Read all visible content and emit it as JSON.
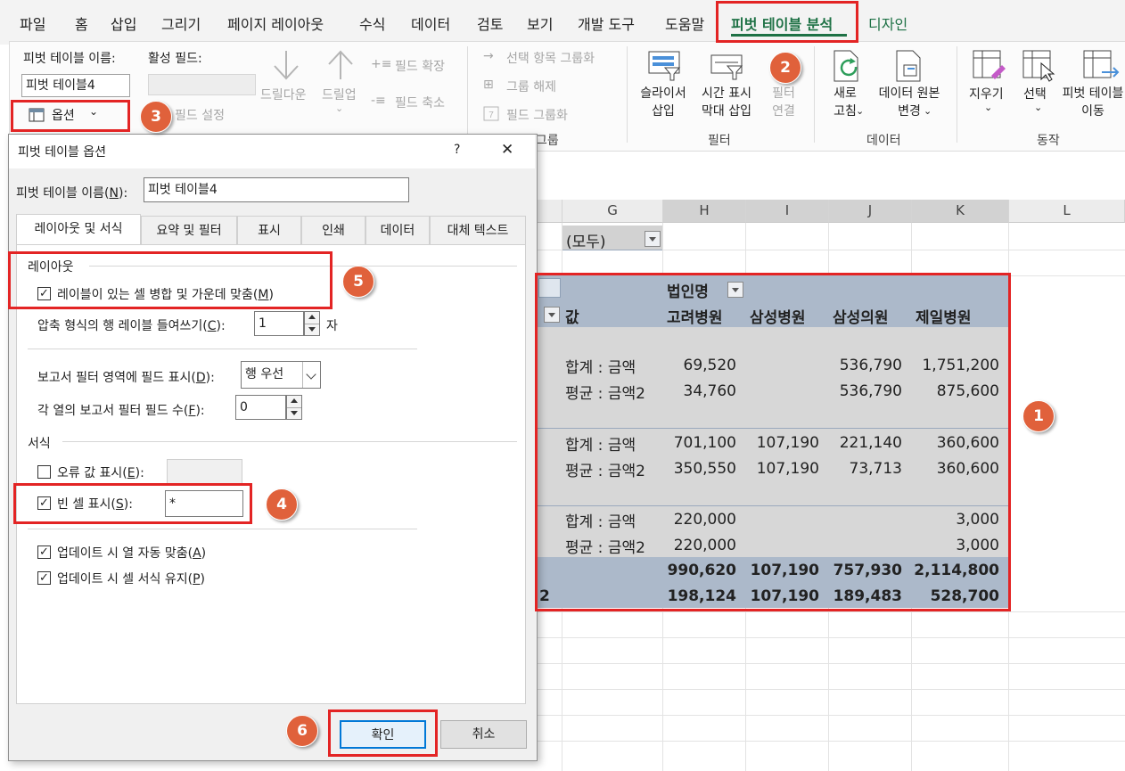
{
  "menu": {
    "tabs": [
      "파일",
      "홈",
      "삽입",
      "그리기",
      "페이지 레이아웃",
      "수식",
      "데이터",
      "검토",
      "보기",
      "개발 도구",
      "도움말",
      "피벗 테이블 분석",
      "디자인"
    ],
    "active": "피벗 테이블 분석",
    "accent_color": "#1e7145"
  },
  "ribbon": {
    "pivot_name_label": "피벗 테이블 이름:",
    "pivot_name_value": "피벗 테이블4",
    "options_label": "옵션",
    "active_field_label": "활성 필드:",
    "field_settings": "필드 설정",
    "drill_down": "드릴다운",
    "drill_up": "드릴업",
    "expand_field": "필드 확장",
    "collapse_field": "필드 축소",
    "group_selection": "선택 항목 그룹화",
    "ungroup": "그룹 해제",
    "group_field": "필드 그룹화",
    "group_label": "그룹",
    "insert_slicer_l1": "슬라이서",
    "insert_slicer_l2": "삽입",
    "insert_timeline_l1": "시간 표시",
    "insert_timeline_l2": "막대 삽입",
    "filter_connections_l1": "필터",
    "filter_connections_l2": "연결",
    "filter_group_label": "필터",
    "refresh_l1": "새로",
    "refresh_l2": "고침",
    "change_source_l1": "데이터 원본",
    "change_source_l2": "변경",
    "data_group_label": "데이터",
    "clear": "지우기",
    "select": "선택",
    "move_l1": "피벗 테이블",
    "move_l2": "이동",
    "actions_group_label": "동작"
  },
  "sheet": {
    "columns": [
      "G",
      "H",
      "I",
      "J",
      "K",
      "L"
    ],
    "filter_value": "(모두)",
    "column_field": "법인명",
    "values_label": "값",
    "hospitals": [
      "고려병원",
      "삼성병원",
      "삼성의원",
      "제일병원"
    ],
    "rows": [
      {
        "label": "합계 : 금액",
        "values": [
          "69,520",
          "",
          "536,790",
          "1,751,200"
        ]
      },
      {
        "label": "평균 : 금액2",
        "values": [
          "34,760",
          "",
          "536,790",
          "875,600"
        ]
      },
      {
        "label": "합계 : 금액",
        "values": [
          "701,100",
          "107,190",
          "221,140",
          "360,600"
        ]
      },
      {
        "label": "평균 : 금액2",
        "values": [
          "350,550",
          "107,190",
          "73,713",
          "360,600"
        ]
      },
      {
        "label": "합계 : 금액",
        "values": [
          "220,000",
          "",
          "",
          "3,000"
        ]
      },
      {
        "label": "평균 : 금액2",
        "values": [
          "220,000",
          "",
          "",
          "3,000"
        ]
      }
    ],
    "total_sum": [
      "990,620",
      "107,190",
      "757,930",
      "2,114,800"
    ],
    "total_avg_prefix": "2",
    "total_avg": [
      "198,124",
      "107,190",
      "189,483",
      "528,700"
    ]
  },
  "dialog": {
    "title": "피벗 테이블 옵션",
    "help": "?",
    "close": "✕",
    "name_label": "피벗 테이블 이름(N):",
    "name_value": "피벗 테이블4",
    "tabs": [
      "레이아웃 및 서식",
      "요약 및 필터",
      "표시",
      "인쇄",
      "데이터",
      "대체 텍스트"
    ],
    "layout_section": "레이아웃",
    "merge_label": "레이블이 있는 셀 병합 및 가운데 맞춤(M)",
    "indent_label": "압축 형식의 행 레이블 들여쓰기(C):",
    "indent_value": "1",
    "indent_unit": "자",
    "report_filter_label": "보고서 필터 영역에 필드 표시(D):",
    "report_filter_value": "행 우선",
    "fields_per_col_label": "각 열의 보고서 필터 필드 수(F):",
    "fields_per_col_value": "0",
    "format_section": "서식",
    "error_label": "오류 값 표시(E):",
    "empty_label": "빈 셀 표시(S):",
    "empty_value": "*",
    "autofit_label": "업데이트 시 열 자동 맞춤(A)",
    "preserve_label": "업데이트 시 셀 서식 유지(P)",
    "ok": "확인",
    "cancel": "취소"
  },
  "annotations": {
    "badges": [
      "1",
      "2",
      "3",
      "4",
      "5",
      "6"
    ],
    "color": "#e32424",
    "badge_color": "#e0613b"
  }
}
